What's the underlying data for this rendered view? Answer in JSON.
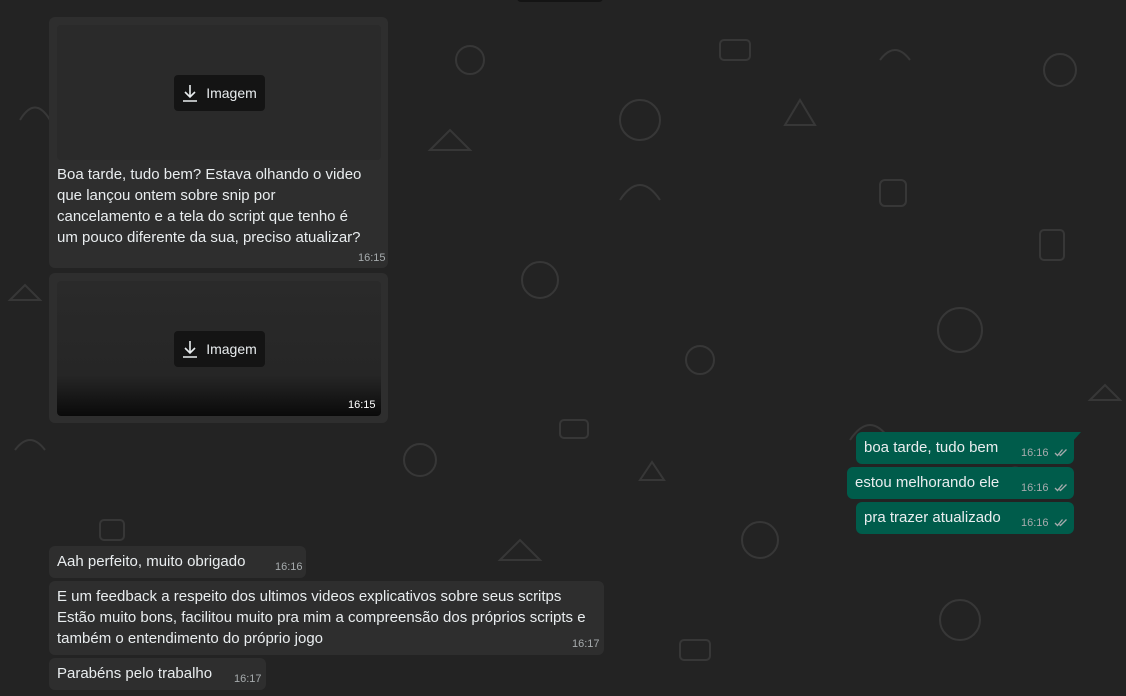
{
  "chat": {
    "messages": [
      {
        "direction": "in",
        "type": "image",
        "attachment_label": "Imagem",
        "caption_lines": [
          "Boa tarde, tudo bem? Estava olhando o video",
          "que lançou ontem sobre snip por",
          "cancelamento e a tela do script que tenho é",
          "um pouco diferente da sua, preciso atualizar?"
        ],
        "time": "16:15"
      },
      {
        "direction": "in",
        "type": "image",
        "attachment_label": "Imagem",
        "time": "16:15"
      },
      {
        "direction": "out",
        "text": "boa tarde, tudo bem",
        "time": "16:16",
        "status": "read"
      },
      {
        "direction": "out",
        "text": "estou melhorando ele",
        "time": "16:16",
        "status": "read"
      },
      {
        "direction": "out",
        "text": "pra trazer atualizado",
        "time": "16:16",
        "status": "read"
      },
      {
        "direction": "in",
        "text": "Aah perfeito, muito obrigado",
        "time": "16:16"
      },
      {
        "direction": "in",
        "text_lines": [
          "E um feedback a respeito dos ultimos videos explicativos sobre seus scritps",
          "Estão muito bons, facilitou muito pra mim a compreensão dos próprios scripts e",
          "também o entendimento do próprio jogo"
        ],
        "time": "16:17"
      },
      {
        "direction": "in",
        "text": "Parabéns pelo trabalho",
        "time": "16:17"
      }
    ]
  },
  "colors": {
    "background": "#232323",
    "incoming_bubble": "#2e2e2e",
    "outgoing_bubble": "#005c4b",
    "read_ticks": "#a6abad"
  },
  "icons": {
    "download": "download-arrow-icon",
    "read_receipt": "double-check-icon"
  }
}
